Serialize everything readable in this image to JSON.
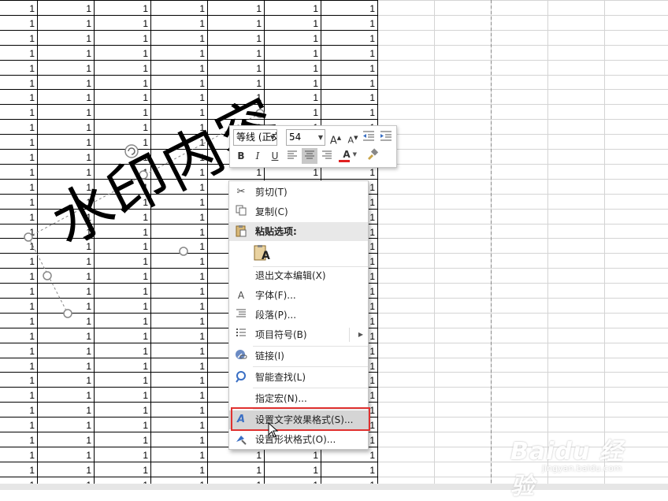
{
  "sheet": {
    "cell_value": "1",
    "visible_rows": 33,
    "filled_columns": 7
  },
  "watermark_shape": {
    "text": "水印内容"
  },
  "mini_toolbar": {
    "font_name": "等线 (正文",
    "font_size": "54",
    "grow_font": "A",
    "shrink_font": "A",
    "bold": "B",
    "italic": "I",
    "underline": "U",
    "font_color": "A",
    "font_color_value": "#e02020"
  },
  "context_menu": {
    "items": [
      {
        "label": "剪切(T)",
        "icon": "scissors-icon"
      },
      {
        "label": "复制(C)",
        "icon": "copy-icon"
      },
      {
        "label": "粘贴选项:",
        "icon": "paste-icon"
      },
      {
        "label": "退出文本编辑(X)"
      },
      {
        "label": "字体(F)...",
        "icon": "font-icon",
        "icon_glyph": "A"
      },
      {
        "label": "段落(P)...",
        "icon": "paragraph-icon"
      },
      {
        "label": "项目符号(B)",
        "icon": "bullets-icon"
      },
      {
        "label": "链接(I)",
        "icon": "link-icon"
      },
      {
        "label": "智能查找(L)",
        "icon": "smart-lookup-icon"
      },
      {
        "label": "指定宏(N)..."
      },
      {
        "label": "设置文字效果格式(S)...",
        "icon": "text-effects-icon",
        "icon_glyph": "A"
      },
      {
        "label": "设置形状格式(O)...",
        "icon": "shape-format-icon"
      }
    ],
    "paste_option_glyph": "A"
  },
  "site_watermark": {
    "logo": "Baidu 经验",
    "url": "jingyan.baidu.com"
  },
  "colors": {
    "highlight_border": "#e0312f",
    "grid_line": "#d4d4d4",
    "cell_border": "#000000"
  }
}
